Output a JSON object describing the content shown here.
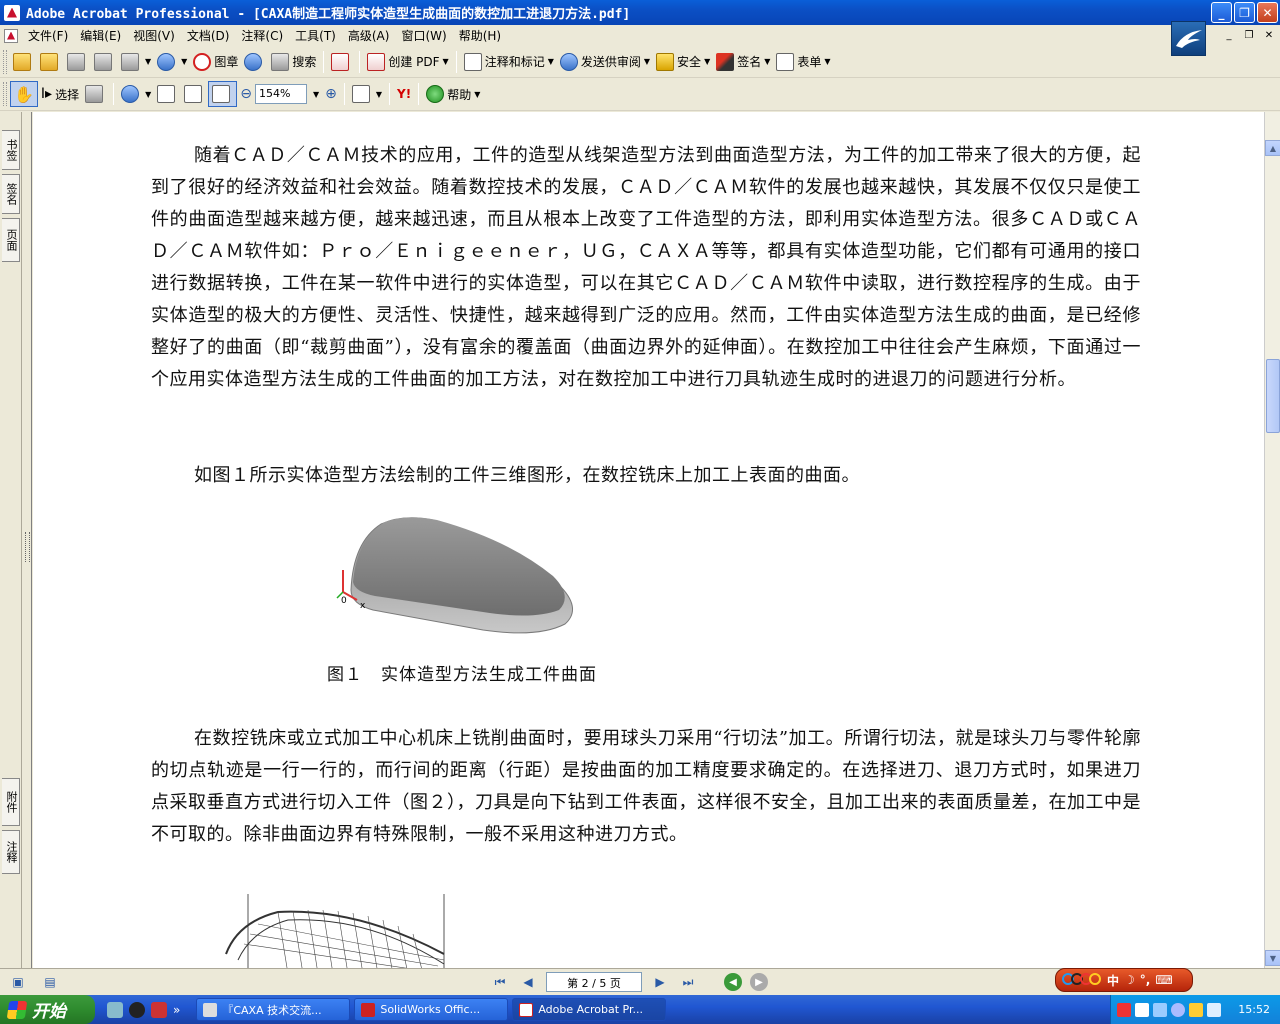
{
  "window": {
    "title": "Adobe Acrobat Professional - [CAXA制造工程师实体造型生成曲面的数控加工进退刀方法.pdf]"
  },
  "menu": [
    "文件(F)",
    "编辑(E)",
    "视图(V)",
    "文档(D)",
    "注释(C)",
    "工具(T)",
    "高级(A)",
    "窗口(W)",
    "帮助(H)"
  ],
  "toolbar1": {
    "stamp": "图章",
    "search": "搜索",
    "create_pdf": "创建 PDF",
    "comment_markup": "注释和标记",
    "send_review": "发送供审阅",
    "security": "安全",
    "sign": "签名",
    "forms": "表单"
  },
  "toolbar2": {
    "select": "选择",
    "zoom_value": "154%",
    "help": "帮助"
  },
  "left_tabs": {
    "bookmarks": "书签",
    "signatures": "签名",
    "pages": "页面",
    "attachments": "附件",
    "comments": "注释"
  },
  "document": {
    "para1": "随着ＣＡＤ／ＣＡＭ技术的应用，工件的造型从线架造型方法到曲面造型方法，为工件的加工带来了很大的方便，起到了很好的经济效益和社会效益。随着数控技术的发展，ＣＡＤ／ＣＡＭ软件的发展也越来越快，其发展不仅仅只是使工件的曲面造型越来越方便，越来越迅速，而且从根本上改变了工件造型的方法，即利用实体造型方法。很多ＣＡＤ或ＣＡＤ／ＣＡＭ软件如：Ｐｒｏ／Ｅｎｉｇｅｅｎｅｒ，ＵＧ，ＣＡＸＡ等等，都具有实体造型功能，它们都有可通用的接口进行数据转换，工件在某一软件中进行的实体造型，可以在其它ＣＡＤ／ＣＡＭ软件中读取，进行数控程序的生成。由于实体造型的极大的方便性、灵活性、快捷性，越来越得到广泛的应用。然而，工件由实体造型方法生成的曲面，是已经修整好了的曲面（即“裁剪曲面”），没有富余的覆盖面（曲面边界外的延伸面）。在数控加工中往往会产生麻烦，下面通过一个应用实体造型方法生成的工件曲面的加工方法，对在数控加工中进行刀具轨迹生成时的进退刀的问题进行分析。",
    "para2": "如图１所示实体造型方法绘制的工件三维图形，在数控铣床上加工上表面的曲面。",
    "fig1_caption": "图１　实体造型方法生成工件曲面",
    "fig1_axis_o": "0",
    "fig1_axis_x": "x",
    "para3": "在数控铣床或立式加工中心机床上铣削曲面时，要用球头刀采用“行切法”加工。所谓行切法，就是球头刀与零件轮廓的切点轨迹是一行一行的，而行间的距离（行距）是按曲面的加工精度要求确定的。在选择进刀、退刀方式时，如果进刀点采取垂直方式进行切入工件（图２），刀具是向下钻到工件表面，这样很不安全，且加工出来的表面质量差，在加工中是不可取的。除非曲面边界有特殊限制，一般不采用这种进刀方式。"
  },
  "statusbar": {
    "page_display": "第 2 / 5 页"
  },
  "ime": {
    "label": "中"
  },
  "taskbar": {
    "start": "开始",
    "tasks": [
      "『CAXA 技术交流...",
      "SolidWorks Offic...",
      "Adobe Acrobat Pr..."
    ],
    "clock": "15:52"
  },
  "colors": {
    "title_bar": "#0b4fc4",
    "taskbar": "#2157d2",
    "start_button": "#2e8b2e",
    "ime_bar": "#c8351a"
  }
}
